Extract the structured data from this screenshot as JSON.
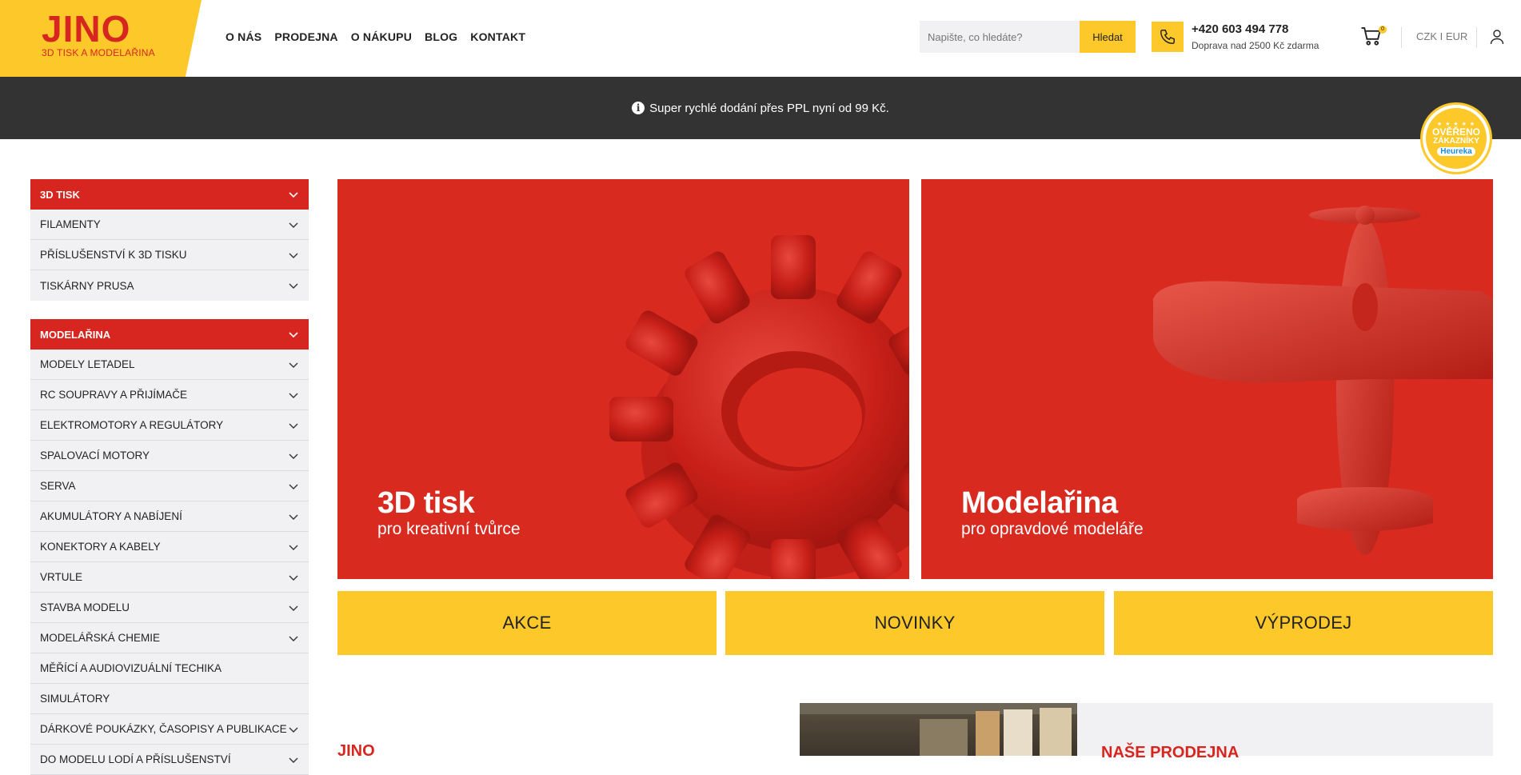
{
  "brand": {
    "name": "JINO",
    "tagline": "3D TISK A MODELAŘINA",
    "primary_yellow": "#fdc82a",
    "primary_red": "#d7261f"
  },
  "nav": {
    "items": [
      "O NÁS",
      "PRODEJNA",
      "O NÁKUPU",
      "BLOG",
      "KONTAKT"
    ]
  },
  "search": {
    "placeholder": "Napište, co hledáte?",
    "button": "Hledat"
  },
  "contact": {
    "phone": "+420 603 494 778",
    "shipping": "Doprava nad 2500 Kč zdarma"
  },
  "cart": {
    "count": "0"
  },
  "currency": {
    "label": "CZK I EUR"
  },
  "infobar": {
    "icon": "info-icon",
    "text": "Super rychlé dodání přes PPL nyní od 99 Kč."
  },
  "heureka": {
    "stars": "★ ★ ★ ★ ★",
    "line1": "OVĚŘENO",
    "line2": "ZÁKAZNÍKY",
    "brand": "Heureka"
  },
  "sidebar": {
    "groups": [
      {
        "title": "3D TISK",
        "items": [
          "FILAMENTY",
          "PŘÍSLUŠENSTVÍ K 3D TISKU",
          "TISKÁRNY PRUSA"
        ]
      },
      {
        "title": "MODELAŘINA",
        "items": [
          "MODELY LETADEL",
          "RC SOUPRAVY A PŘIJÍMAČE",
          "ELEKTROMOTORY A REGULÁTORY",
          "SPALOVACÍ MOTORY",
          "SERVA",
          "AKUMULÁTORY A NABÍJENÍ",
          "KONEKTORY A KABELY",
          "VRTULE",
          "STAVBA MODELU",
          "MODELÁŘSKÁ CHEMIE",
          "MĚŘÍCÍ A AUDIOVIZUÁLNÍ TECHIKA",
          "SIMULÁTORY",
          "DÁRKOVÉ POUKÁZKY, ČASOPISY A PUBLIKACE",
          "DO MODELU LODÍ A PŘÍSLUŠENSTVÍ"
        ]
      }
    ]
  },
  "banners": [
    {
      "title": "3D tisk",
      "subtitle": "pro kreativní tvůrce"
    },
    {
      "title": "Modelařina",
      "subtitle": "pro opravdové modeláře"
    }
  ],
  "tiles": [
    "AKCE",
    "NOVINKY",
    "VÝPRODEJ"
  ],
  "bottom": {
    "left_title": "JINO",
    "right_title": "NAŠE PRODEJNA"
  }
}
